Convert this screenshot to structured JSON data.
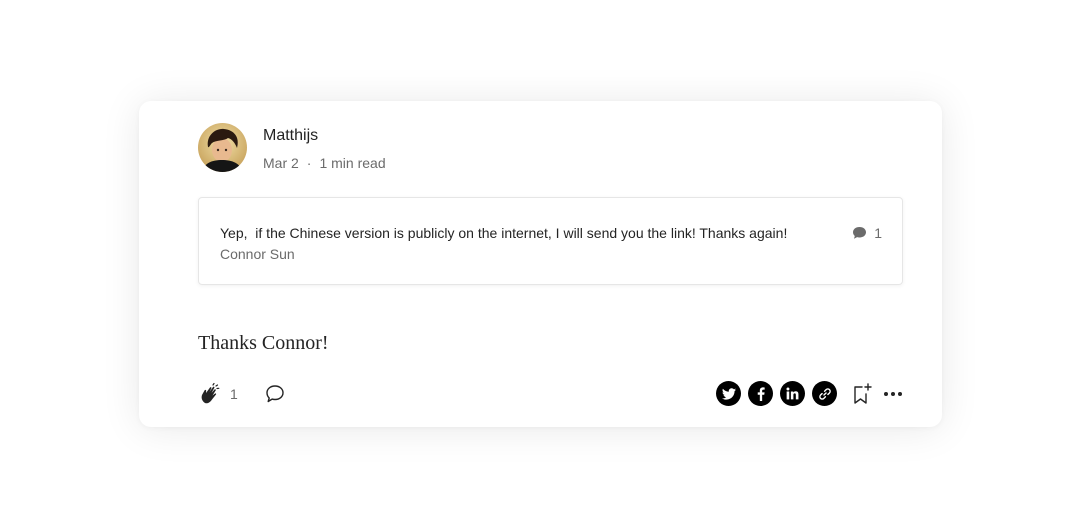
{
  "post": {
    "author": "Matthijs",
    "date": "Mar 2",
    "separator": "·",
    "read_time": "1 min read",
    "quote": {
      "text": "Yep,  if the Chinese version is publicly on the internet, I will send you the link! Thanks again!",
      "author": "Connor Sun",
      "response_count": "1"
    },
    "body": "Thanks Connor!",
    "clap_count": "1"
  },
  "icons": {
    "clap": "clap-icon",
    "respond": "speech-bubble-icon",
    "share": [
      "twitter-icon",
      "facebook-icon",
      "linkedin-icon",
      "link-icon"
    ],
    "bookmark": "bookmark-add-icon",
    "more": "more-horizontal-icon"
  },
  "colors": {
    "text": "#242424",
    "muted": "#6b6b6b",
    "share_bg": "#000000"
  }
}
